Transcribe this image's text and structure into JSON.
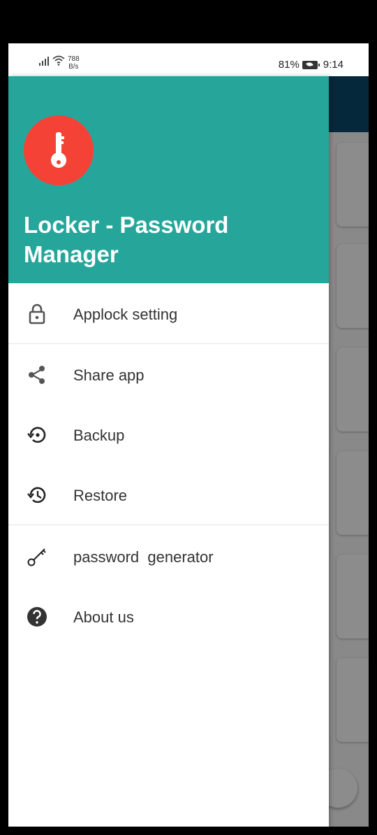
{
  "status_bar": {
    "net_speed_value": "788",
    "net_speed_unit": "B/s",
    "battery_percent": "81%",
    "time": "9:14"
  },
  "drawer": {
    "app_title": "Locker - Password Manager",
    "header_color": "#26a69a",
    "logo_color": "#f44336",
    "items": [
      {
        "label": "Applock setting",
        "icon": "lock-icon"
      },
      {
        "label": "Share app",
        "icon": "share-icon"
      },
      {
        "label": "Backup",
        "icon": "backup-icon"
      },
      {
        "label": "Restore",
        "icon": "restore-history-icon"
      },
      {
        "label": "password  generator",
        "icon": "key-icon"
      },
      {
        "label": "About us",
        "icon": "help-circle-icon"
      }
    ]
  },
  "background_app": {
    "appbar_color": "#0a4a6a"
  }
}
